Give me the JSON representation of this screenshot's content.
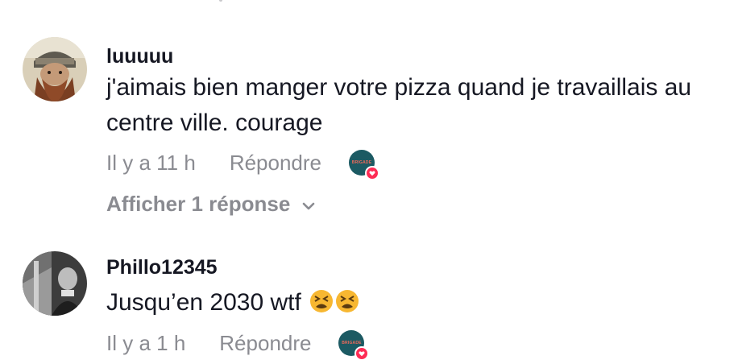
{
  "comments": [
    {
      "username": "luuuuu",
      "text": "j'aimais bien manger votre pizza quand je travaillais au centre ville. courage",
      "time": "Il y a 11 h",
      "reply_label": "Répondre",
      "creator_badge_text": "BRIGADE",
      "view_replies_label": "Afficher 1 réponse"
    },
    {
      "username": "Phillo12345",
      "text": "Jusqu’en 2030 wtf",
      "time": "Il y a 1 h",
      "reply_label": "Répondre",
      "creator_badge_text": "BRIGADE"
    }
  ],
  "icons": {
    "chevron": "chevron-down-icon",
    "heart": "heart-icon",
    "emoji": "tired-face-emoji"
  },
  "colors": {
    "text": "#161823",
    "muted": "#8a8b91",
    "like_red": "#fe2c55",
    "brand_teal": "#1c5a63"
  }
}
